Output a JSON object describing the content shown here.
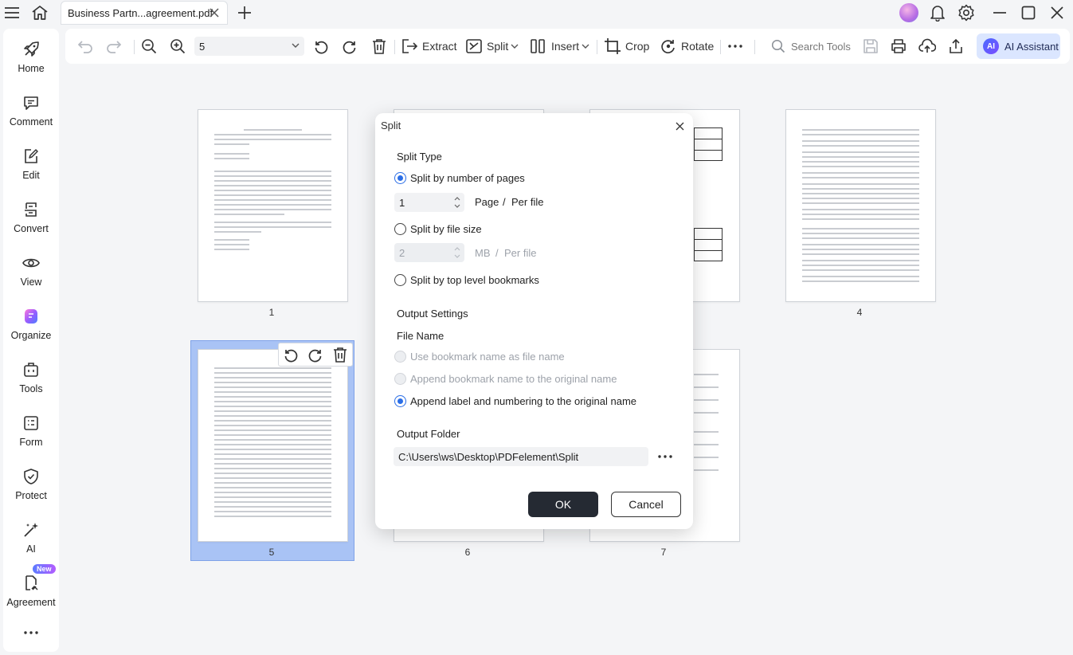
{
  "titlebar": {
    "tab_title": "Business Partn...agreement.pdf"
  },
  "sidebar": {
    "items": [
      {
        "label": "Home",
        "icon": "home-rocket-icon"
      },
      {
        "label": "Comment",
        "icon": "comment-icon"
      },
      {
        "label": "Edit",
        "icon": "edit-icon"
      },
      {
        "label": "Convert",
        "icon": "convert-icon"
      },
      {
        "label": "View",
        "icon": "view-icon"
      },
      {
        "label": "Organize",
        "icon": "organize-icon"
      },
      {
        "label": "Tools",
        "icon": "tools-icon"
      },
      {
        "label": "Form",
        "icon": "form-icon"
      },
      {
        "label": "Protect",
        "icon": "protect-icon"
      },
      {
        "label": "AI",
        "icon": "ai-wand-icon"
      },
      {
        "label": "Agreement",
        "icon": "agreement-icon",
        "badge": "New"
      }
    ]
  },
  "toolbar": {
    "page_value": "5",
    "extract": "Extract",
    "split": "Split",
    "insert": "Insert",
    "crop": "Crop",
    "rotate": "Rotate",
    "search_tools": "Search Tools",
    "ai_assistant": "AI Assistant",
    "ai_logo": "AI"
  },
  "pages": [
    {
      "number": "1"
    },
    {
      "number": "4"
    },
    {
      "number": "5"
    },
    {
      "number": "6"
    },
    {
      "number": "7"
    }
  ],
  "dialog": {
    "title": "Split",
    "split_type_title": "Split Type",
    "by_pages_label": "Split by number of pages",
    "pages_value": "1",
    "pages_unit": "Page",
    "pages_slash": "/",
    "pages_per": "Per file",
    "by_size_label": "Split by file size",
    "size_value": "2",
    "size_unit": "MB",
    "size_slash": "/",
    "size_per": "Per file",
    "by_bookmarks_label": "Split by top level bookmarks",
    "output_settings_title": "Output Settings",
    "file_name_title": "File Name",
    "opt_bookmark_name": "Use bookmark name as file name",
    "opt_append_bookmark": "Append bookmark name to the original name",
    "opt_append_label": "Append label and numbering to the original name",
    "output_folder_title": "Output Folder",
    "output_folder_value": "C:\\Users\\ws\\Desktop\\PDFelement\\Split",
    "ok": "OK",
    "cancel": "Cancel",
    "selected_split_type": "by_pages",
    "selected_file_name": "append_label"
  },
  "colors": {
    "accent": "#2b6ee6",
    "selection": "#a9c3f5",
    "ok_button": "#252a33",
    "ai_button": "#dbe6ff"
  }
}
